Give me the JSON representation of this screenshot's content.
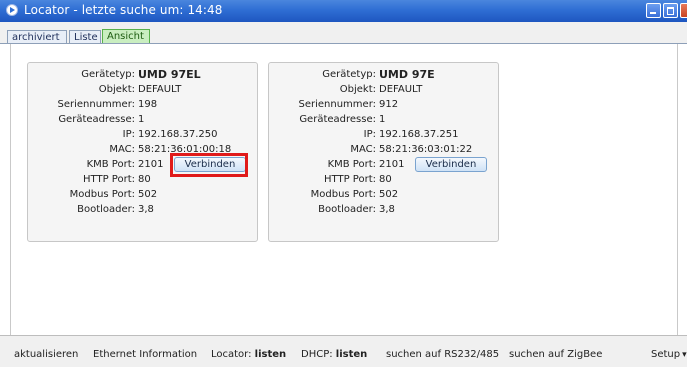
{
  "window": {
    "title": "Locator - letzte suche um: 14:48"
  },
  "tabs": [
    {
      "label": "archiviert"
    },
    {
      "label": "Liste"
    },
    {
      "label": "Ansicht",
      "active": true
    }
  ],
  "labels": {
    "geraetetyp": "Gerätetyp:",
    "objekt": "Objekt:",
    "seriennummer": "Seriennummer:",
    "geraeteadresse": "Geräteadresse:",
    "ip": "IP:",
    "mac": "MAC:",
    "kmb_port": "KMB Port:",
    "http_port": "HTTP Port:",
    "modbus_port": "Modbus Port:",
    "bootloader": "Bootloader:"
  },
  "devices": [
    {
      "geraetetyp": "UMD 97EL",
      "objekt": "DEFAULT",
      "seriennummer": "198",
      "geraeteadresse": "1",
      "ip": "192.168.37.250",
      "mac": "58:21:36:01:00:18",
      "kmb_port": "2101",
      "http_port": "80",
      "modbus_port": "502",
      "bootloader": "3,8",
      "connect_label": "Verbinden"
    },
    {
      "geraetetyp": "UMD 97E",
      "objekt": "DEFAULT",
      "seriennummer": "912",
      "geraeteadresse": "1",
      "ip": "192.168.37.251",
      "mac": "58:21:36:03:01:22",
      "kmb_port": "2101",
      "http_port": "80",
      "modbus_port": "502",
      "bootloader": "3,8",
      "connect_label": "Verbinden"
    }
  ],
  "statusbar": {
    "refresh": "aktualisieren",
    "ethernet_info": "Ethernet Information",
    "locator_label": "Locator:",
    "locator_value": "listen",
    "dhcp_label": "DHCP:",
    "dhcp_value": "listen",
    "search_rs": "suchen auf RS232/485",
    "search_zigbee": "suchen auf ZigBee",
    "setup": "Setup"
  },
  "colors": {
    "titlebar": "#2f6ed4",
    "active_tab": "#c9eec0",
    "highlight": "#e01a1a"
  }
}
